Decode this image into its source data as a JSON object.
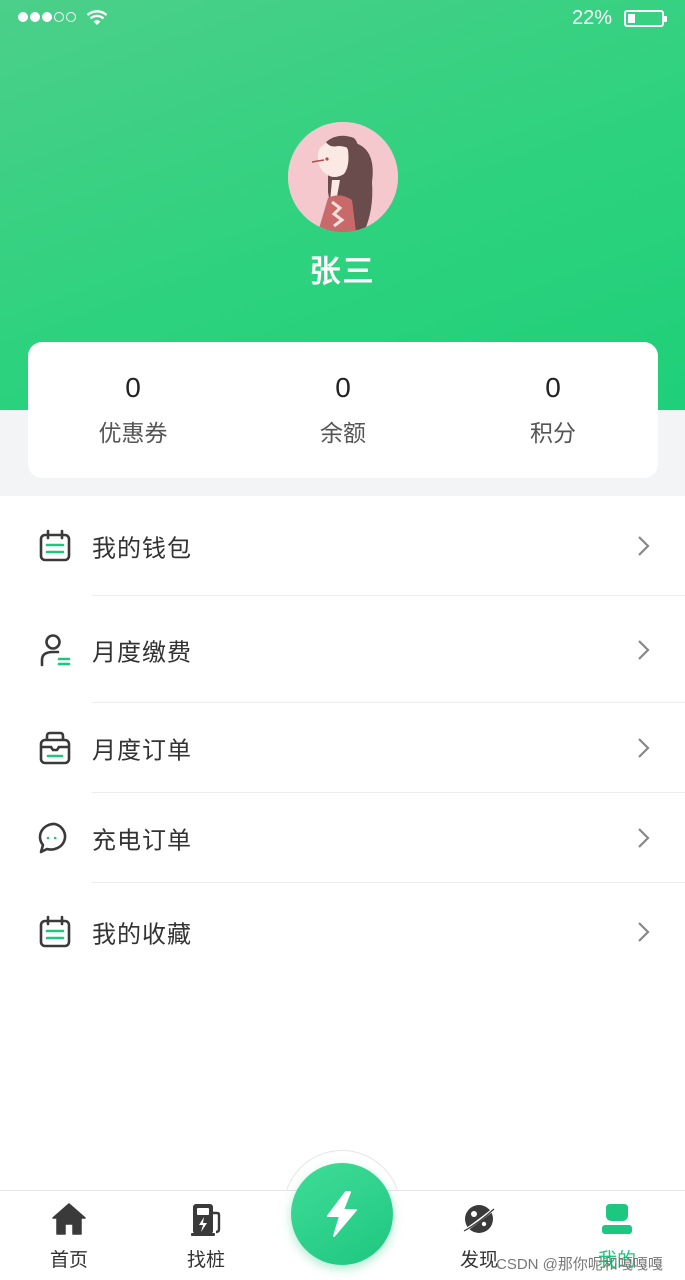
{
  "status_bar": {
    "battery_percent_text": "22%",
    "battery_level": 0.22,
    "signal_dots_filled": 3,
    "signal_dots_total": 5
  },
  "profile": {
    "username": "张三",
    "avatar_icon": "avatar-girl-icon"
  },
  "stats": [
    {
      "value": "0",
      "label": "优惠券"
    },
    {
      "value": "0",
      "label": "余额"
    },
    {
      "value": "0",
      "label": "积分"
    }
  ],
  "menu": [
    {
      "label": "我的钱包",
      "icon": "wallet-icon"
    },
    {
      "label": "月度缴费",
      "icon": "user-payment-icon"
    },
    {
      "label": "月度订单",
      "icon": "order-box-icon"
    },
    {
      "label": "充电订单",
      "icon": "chat-bubble-icon"
    },
    {
      "label": "我的收藏",
      "icon": "calendar-icon"
    }
  ],
  "tabs": [
    {
      "label": "首页",
      "icon": "home-icon"
    },
    {
      "label": "找桩",
      "icon": "charging-pile-icon"
    },
    {
      "label": "发现",
      "icon": "planet-icon"
    },
    {
      "label": "我的",
      "icon": "user-icon",
      "active": true
    }
  ],
  "center_button": {
    "icon": "lightning-icon"
  },
  "watermark": "CSDN @那你呢和嘎嘎嘎",
  "colors": {
    "accent": "#1ec77f",
    "header_gradient_start": "#4ccf8a",
    "header_gradient_end": "#1fcf79"
  }
}
